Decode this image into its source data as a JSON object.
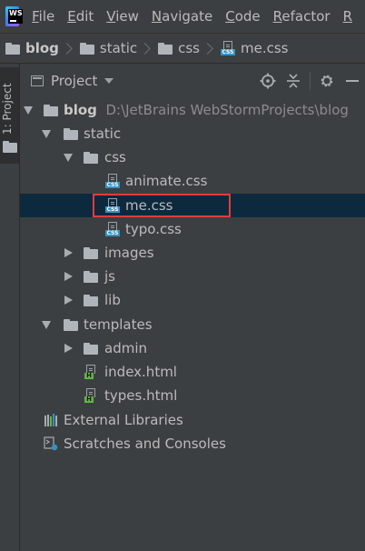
{
  "menubar": {
    "items": [
      {
        "mnemonic": "F",
        "rest": "ile"
      },
      {
        "mnemonic": "E",
        "rest": "dit"
      },
      {
        "mnemonic": "V",
        "rest": "iew"
      },
      {
        "mnemonic": "N",
        "rest": "avigate"
      },
      {
        "mnemonic": "C",
        "rest": "ode"
      },
      {
        "mnemonic": "R",
        "rest": "efactor"
      },
      {
        "mnemonic": "R",
        "rest": ""
      }
    ]
  },
  "breadcrumb": [
    "blog",
    "static",
    "css",
    "me.css"
  ],
  "left_strip": {
    "tab_label": "1: Project"
  },
  "project_panel": {
    "title": "Project"
  },
  "tree": {
    "blog": {
      "label": "blog",
      "path": "D:\\JetBrains WebStormProjects\\blog"
    },
    "static": "static",
    "css": "css",
    "animate": "animate.css",
    "me": "me.css",
    "typo": "typo.css",
    "images": "images",
    "js": "js",
    "lib": "lib",
    "templates": "templates",
    "admin": "admin",
    "index": "index.html",
    "types": "types.html",
    "external": "External Libraries",
    "scratches": "Scratches and Consoles"
  },
  "colors": {
    "background": "#3c3f41",
    "selection": "#0d293e",
    "highlight_box": "#e43b3b",
    "css_badge": "#3592c4",
    "html_badge": "#62b543"
  },
  "icons": {
    "app": "webstorm-logo",
    "tools": [
      "locate-icon",
      "collapse-all-icon",
      "settings-gear-icon",
      "minimize-icon"
    ]
  }
}
